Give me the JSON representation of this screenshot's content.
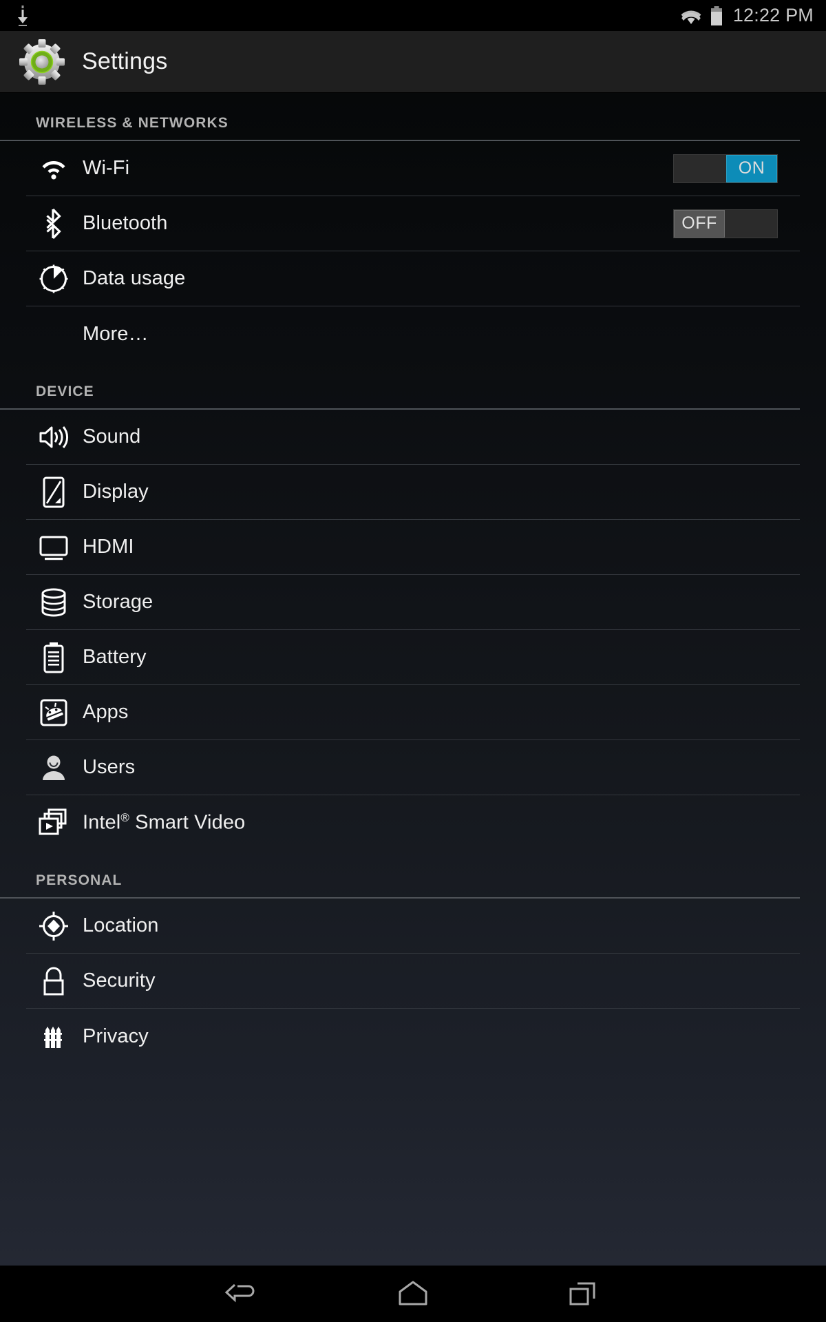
{
  "status_bar": {
    "download_icon": "download-icon",
    "wifi_icon": "wifi-signal-icon",
    "battery_icon": "battery-icon",
    "clock": "12:22 PM"
  },
  "action_bar": {
    "icon": "settings-gear-icon",
    "title": "Settings"
  },
  "colors": {
    "toggle_on": "#0d8cb8",
    "toggle_off": "#545454",
    "text": "#f0f0f0",
    "section_header_text": "#b3b3b3"
  },
  "sections": [
    {
      "label": "WIRELESS & NETWORKS",
      "rows": [
        {
          "icon": "wifi-icon",
          "label": "Wi-Fi",
          "toggle": "ON"
        },
        {
          "icon": "bluetooth-icon",
          "label": "Bluetooth",
          "toggle": "OFF"
        },
        {
          "icon": "data-usage-icon",
          "label": "Data usage",
          "toggle": null
        },
        {
          "icon": null,
          "label": "More…",
          "toggle": null
        }
      ]
    },
    {
      "label": "DEVICE",
      "rows": [
        {
          "icon": "sound-icon",
          "label": "Sound",
          "toggle": null
        },
        {
          "icon": "display-icon",
          "label": "Display",
          "toggle": null
        },
        {
          "icon": "hdmi-icon",
          "label": "HDMI",
          "toggle": null
        },
        {
          "icon": "storage-icon",
          "label": "Storage",
          "toggle": null
        },
        {
          "icon": "battery-icon",
          "label": "Battery",
          "toggle": null
        },
        {
          "icon": "apps-icon",
          "label": "Apps",
          "toggle": null
        },
        {
          "icon": "users-icon",
          "label": "Users",
          "toggle": null
        },
        {
          "icon": "smart-video-icon",
          "label": "Intel® Smart Video",
          "label_main": "Intel",
          "label_sup": "®",
          "label_rest": " Smart Video",
          "toggle": null
        }
      ]
    },
    {
      "label": "PERSONAL",
      "rows": [
        {
          "icon": "location-icon",
          "label": "Location",
          "toggle": null
        },
        {
          "icon": "security-icon",
          "label": "Security",
          "toggle": null
        },
        {
          "icon": "privacy-icon",
          "label": "Privacy",
          "toggle": null
        }
      ]
    }
  ],
  "nav_bar": {
    "back": "back-icon",
    "home": "home-icon",
    "recents": "recent-apps-icon"
  }
}
